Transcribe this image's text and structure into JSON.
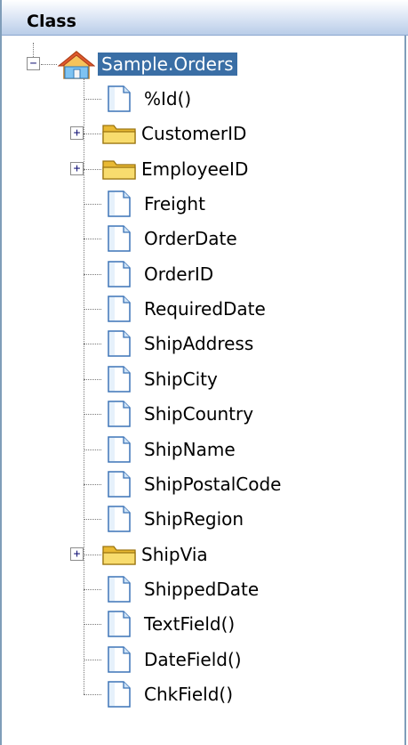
{
  "header": {
    "title": "Class"
  },
  "root": {
    "label": "Sample.Orders",
    "expander": "−"
  },
  "children": [
    {
      "label": "%Id()",
      "type": "file"
    },
    {
      "label": "CustomerID",
      "type": "folder",
      "expander": "+"
    },
    {
      "label": "EmployeeID",
      "type": "folder",
      "expander": "+"
    },
    {
      "label": "Freight",
      "type": "file"
    },
    {
      "label": "OrderDate",
      "type": "file"
    },
    {
      "label": "OrderID",
      "type": "file"
    },
    {
      "label": "RequiredDate",
      "type": "file"
    },
    {
      "label": "ShipAddress",
      "type": "file"
    },
    {
      "label": "ShipCity",
      "type": "file"
    },
    {
      "label": "ShipCountry",
      "type": "file"
    },
    {
      "label": "ShipName",
      "type": "file"
    },
    {
      "label": "ShipPostalCode",
      "type": "file"
    },
    {
      "label": "ShipRegion",
      "type": "file"
    },
    {
      "label": "ShipVia",
      "type": "folder",
      "expander": "+"
    },
    {
      "label": "ShippedDate",
      "type": "file"
    },
    {
      "label": "TextField()",
      "type": "file"
    },
    {
      "label": "DateField()",
      "type": "file"
    },
    {
      "label": "ChkField()",
      "type": "file"
    }
  ]
}
